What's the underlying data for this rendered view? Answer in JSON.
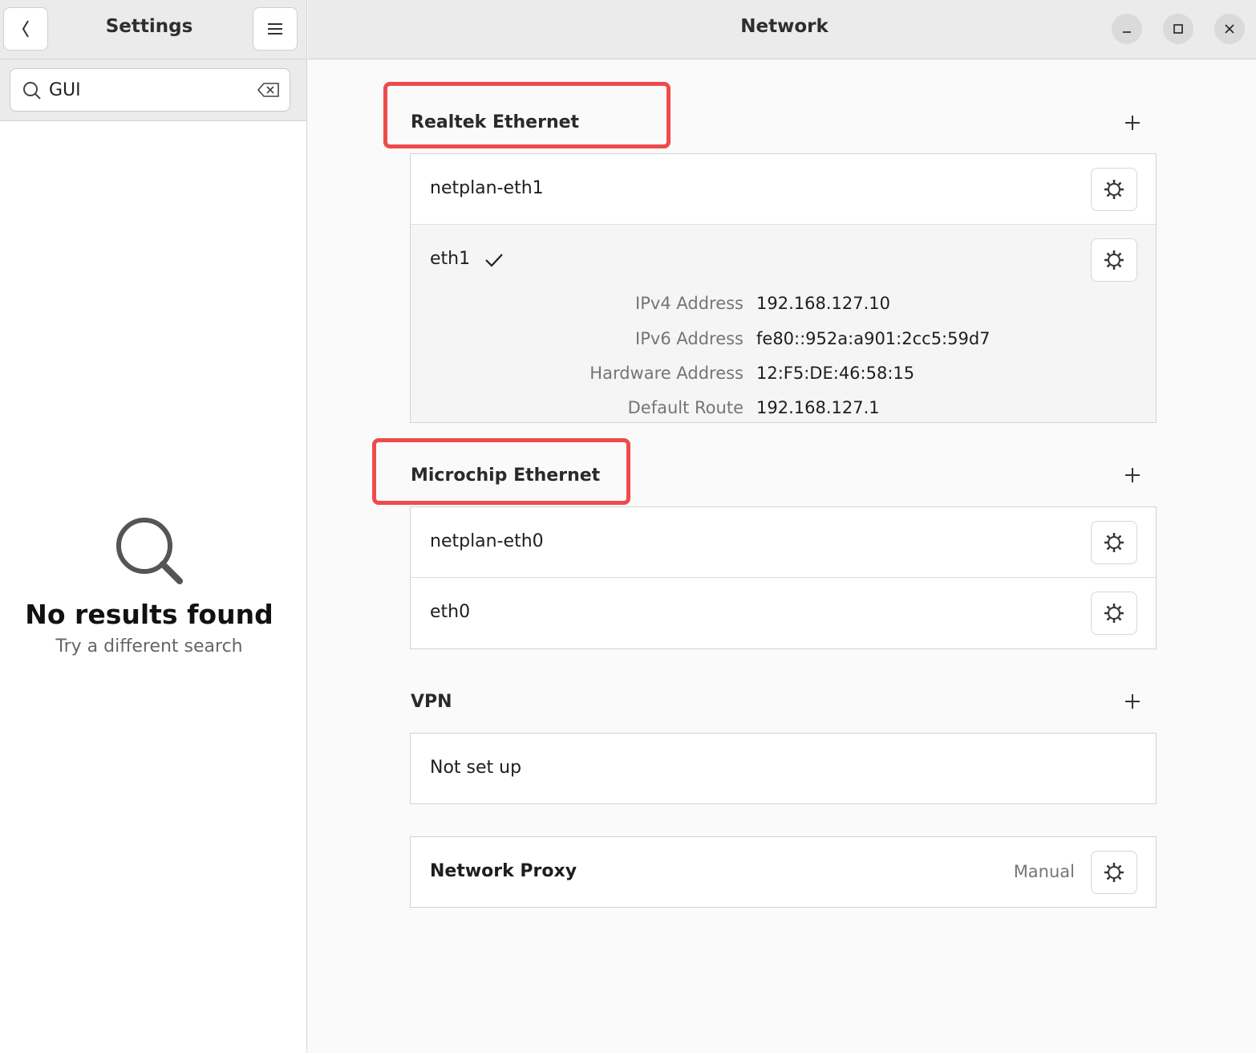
{
  "sidebar": {
    "title": "Settings",
    "search": {
      "value": "GUI",
      "placeholder": ""
    },
    "empty_state": {
      "title": "No results found",
      "subtitle": "Try a different search"
    }
  },
  "window": {
    "title": "Network"
  },
  "sections": {
    "realtek": {
      "title": "Realtek Ethernet",
      "connections": [
        {
          "name": "netplan-eth1"
        },
        {
          "name": "eth1",
          "active": true,
          "details": [
            {
              "key": "IPv4 Address",
              "value": "192.168.127.10"
            },
            {
              "key": "IPv6 Address",
              "value": "fe80::952a:a901:2cc5:59d7"
            },
            {
              "key": "Hardware Address",
              "value": "12:F5:DE:46:58:15"
            },
            {
              "key": "Default Route",
              "value": "192.168.127.1"
            }
          ]
        }
      ]
    },
    "microchip": {
      "title": "Microchip Ethernet",
      "connections": [
        {
          "name": "netplan-eth0"
        },
        {
          "name": "eth0"
        }
      ]
    },
    "vpn": {
      "title": "VPN",
      "status": "Not set up"
    },
    "proxy": {
      "title": "Network Proxy",
      "status": "Manual"
    }
  },
  "colors": {
    "highlight": "#ef4b4b"
  }
}
